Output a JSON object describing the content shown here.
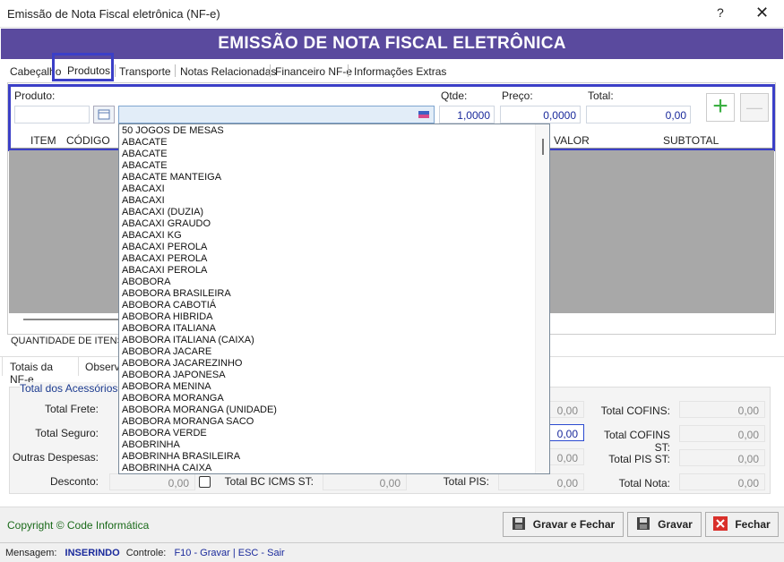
{
  "window": {
    "title": "Emissão de Nota Fiscal eletrônica (NF-e)",
    "help": "?",
    "close": "✕"
  },
  "header": {
    "title": "EMISSÃO DE NOTA FISCAL ELETRÔNICA"
  },
  "tabs": [
    "Cabeçalho",
    "Produtos",
    "Transporte",
    "Notas Relacionadas",
    "Financeiro NF-e",
    "Informações Extras"
  ],
  "produto": {
    "label": "Produto:",
    "qtde_label": "Qtde:",
    "preco_label": "Preço:",
    "total_label": "Total:",
    "qtde": "1,0000",
    "preco": "0,0000",
    "total": "0,00",
    "add": "+",
    "remove": "—"
  },
  "grid": {
    "columns": [
      "ITEM",
      "CÓDIGO",
      "VALOR",
      "SUBTOTAL"
    ]
  },
  "dropdown": {
    "items": [
      "50 JOGOS DE MESAS",
      "ABACATE",
      "ABACATE",
      "ABACATE",
      "ABACATE MANTEIGA",
      "ABACAXI",
      "ABACAXI",
      "ABACAXI (DUZIA)",
      "ABACAXI GRAUDO",
      "ABACAXI KG",
      "ABACAXI PEROLA",
      "ABACAXI PEROLA",
      "ABACAXI PEROLA",
      "ABOBORA",
      "ABOBORA BRASILEIRA",
      "ABOBORA CABOTIÁ",
      "ABOBORA HIBRIDA",
      "ABOBORA ITALIANA",
      "ABOBORA ITALIANA (CAIXA)",
      "ABOBORA JACARE",
      "ABOBORA JACAREZINHO",
      "ABOBORA JAPONESA",
      "ABOBORA MENINA",
      "ABOBORA MORANGA",
      "ABOBORA MORANGA (UNIDADE)",
      "ABOBORA MORANGA SACO",
      "ABOBORA VERDE",
      "ABOBRINHA",
      "ABOBRINHA BRASILEIRA",
      "ABOBRINHA CAIXA"
    ]
  },
  "quantidade_label": "QUANTIDADE DE ITENS:",
  "bottom_tabs": [
    "Totais da NF-e",
    "Observa"
  ],
  "totais": {
    "acessorios_title": "Total dos Acessórios",
    "frete": "Total Frete:",
    "seguro": "Total Seguro:",
    "outras": "Outras Despesas:",
    "desconto": "Desconto:",
    "desconto_val": "0,00",
    "bc_icms_st": "Total BC ICMS ST:",
    "bc_icms_st_val": "0,00",
    "pis": "Total PIS:",
    "pis_val": "0,00",
    "mid_vals": [
      "0,00",
      "0,00",
      "0,00"
    ],
    "cofins": "Total COFINS:",
    "cofins_val": "0,00",
    "cofins_st": "Total COFINS ST:",
    "cofins_st_val": "0,00",
    "pis_st": "Total PIS ST:",
    "pis_st_val": "0,00",
    "nota": "Total Nota:",
    "nota_val": "0,00"
  },
  "footer": {
    "copyright": "Copyright © Code Informática",
    "gravar_fechar": "Gravar e Fechar",
    "gravar": "Gravar",
    "fechar": "Fechar"
  },
  "status": {
    "mensagem_label": "Mensagem:",
    "mensagem": "INSERINDO",
    "controle_label": "Controle:",
    "controle": "F10 - Gravar | ESC - Sair"
  },
  "colors": {
    "header": "#5a4a9e",
    "highlight": "#3b3fc7",
    "add": "#3cb043",
    "close_btn": "#d9302b"
  }
}
